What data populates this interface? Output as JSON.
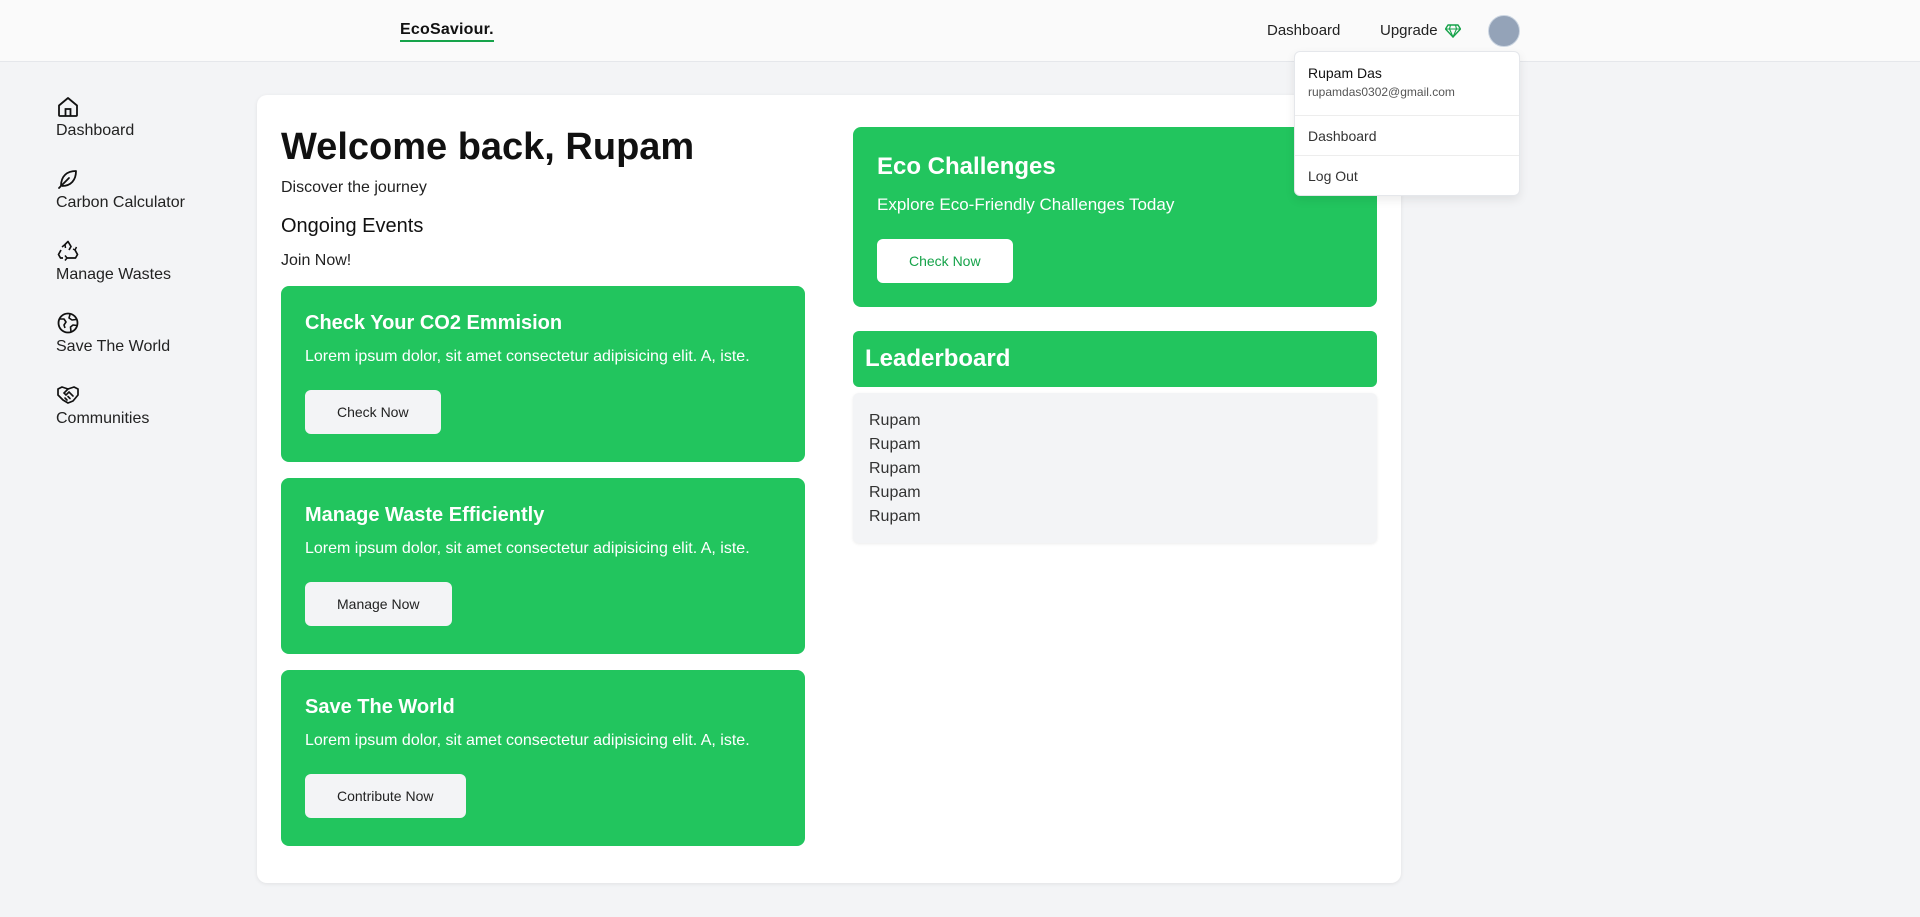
{
  "header": {
    "logo": "EcoSaviour.",
    "nav_dashboard": "Dashboard",
    "nav_upgrade": "Upgrade"
  },
  "dropdown": {
    "name": "Rupam Das",
    "email": "rupamdas0302@gmail.com",
    "items": [
      "Dashboard",
      "Log Out"
    ]
  },
  "sidebar": {
    "items": [
      {
        "label": "Dashboard",
        "icon": "home-icon"
      },
      {
        "label": "Carbon Calculator",
        "icon": "leaf-icon"
      },
      {
        "label": "Manage Wastes",
        "icon": "recycle-icon"
      },
      {
        "label": "Save The World",
        "icon": "globe-icon"
      },
      {
        "label": "Communities",
        "icon": "handshake-icon"
      }
    ]
  },
  "main": {
    "welcome": "Welcome back, Rupam",
    "subtitle": "Discover the journey",
    "ongoing_title": "Ongoing Events",
    "join": "Join Now!",
    "cards": [
      {
        "title": "Check Your CO2 Emmision",
        "text": "Lorem ipsum dolor, sit amet consectetur adipisicing elit. A, iste.",
        "button": "Check Now"
      },
      {
        "title": "Manage Waste Efficiently",
        "text": "Lorem ipsum dolor, sit amet consectetur adipisicing elit. A, iste.",
        "button": "Manage Now"
      },
      {
        "title": "Save The World",
        "text": "Lorem ipsum dolor, sit amet consectetur adipisicing elit. A, iste.",
        "button": "Contribute Now"
      }
    ],
    "eco": {
      "title": "Eco Challenges",
      "text": "Explore Eco-Friendly Challenges Today",
      "button": "Check Now"
    },
    "leaderboard": {
      "title": "Leaderboard",
      "rows": [
        "Rupam",
        "Rupam",
        "Rupam",
        "Rupam",
        "Rupam"
      ]
    }
  },
  "colors": {
    "accent_green": "#22c55e",
    "dark_green": "#16a34a",
    "avatar": "#94a3b8"
  }
}
